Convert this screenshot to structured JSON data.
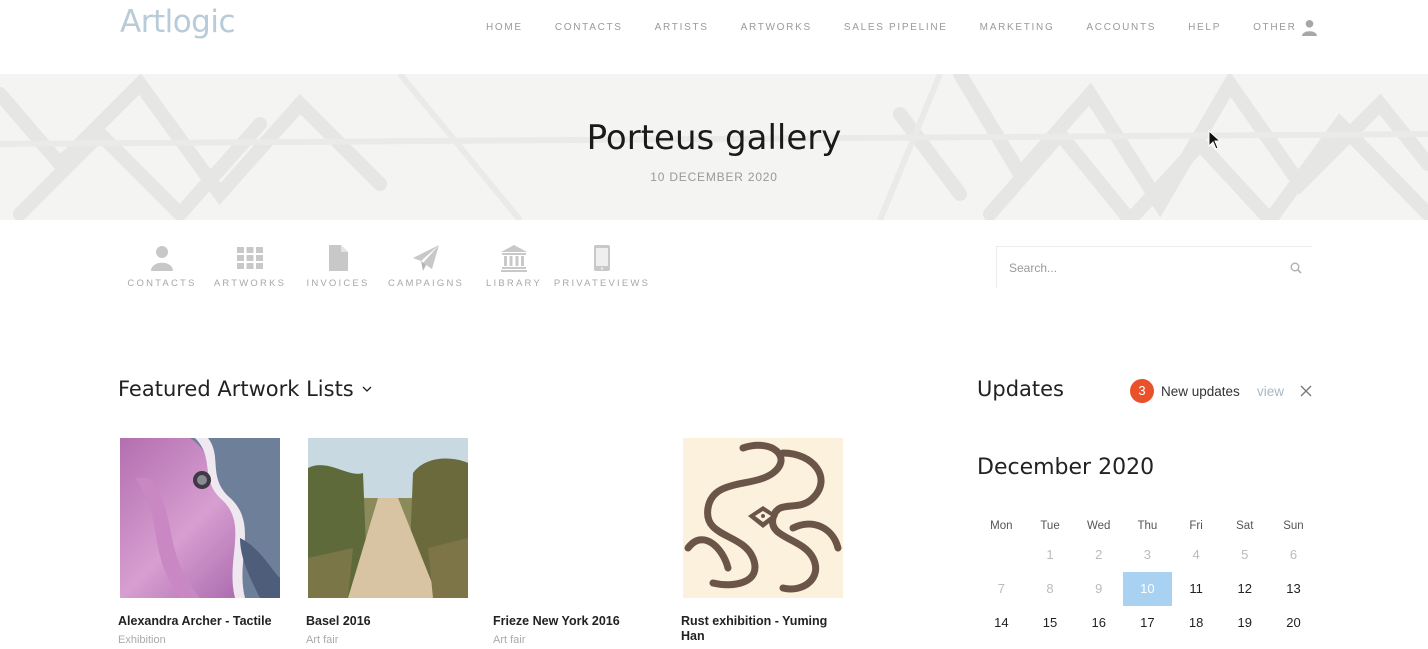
{
  "header": {
    "logo": "Artlogic",
    "nav": [
      "HOME",
      "CONTACTS",
      "ARTISTS",
      "ARTWORKS",
      "SALES PIPELINE",
      "MARKETING",
      "ACCOUNTS",
      "HELP",
      "OTHER"
    ]
  },
  "banner": {
    "title": "Porteus gallery",
    "date": "10 DECEMBER 2020"
  },
  "quick_links": [
    {
      "label": "CONTACTS",
      "icon": "person-icon"
    },
    {
      "label": "ARTWORKS",
      "icon": "grid-icon"
    },
    {
      "label": "INVOICES",
      "icon": "document-icon"
    },
    {
      "label": "CAMPAIGNS",
      "icon": "paper-plane-icon"
    },
    {
      "label": "LIBRARY",
      "icon": "bank-icon"
    },
    {
      "label": "PRIVATEVIEWS",
      "icon": "tablet-icon"
    }
  ],
  "search": {
    "placeholder": "Search..."
  },
  "featured": {
    "title": "Featured Artwork Lists",
    "cards": [
      {
        "name": "Alexandra Archer - Tactile",
        "type": "Exhibition"
      },
      {
        "name": "Basel 2016",
        "type": "Art fair"
      },
      {
        "name": "Frieze New York 2016",
        "type": "Art fair"
      },
      {
        "name": "Rust exhibition - Yuming Han",
        "type": ""
      }
    ]
  },
  "updates": {
    "title": "Updates",
    "count": "3",
    "label": "New updates",
    "view": "view"
  },
  "calendar": {
    "month": "December 2020",
    "weekdays": [
      "Mon",
      "Tue",
      "Wed",
      "Thu",
      "Fri",
      "Sat",
      "Sun"
    ],
    "rows": [
      [
        "",
        "1",
        "2",
        "3",
        "4",
        "5",
        "6"
      ],
      [
        "7",
        "8",
        "9",
        "10",
        "11",
        "12",
        "13"
      ],
      [
        "14",
        "15",
        "16",
        "17",
        "18",
        "19",
        "20"
      ]
    ],
    "today": "10"
  },
  "colors": {
    "accent": "#a9d2f2",
    "badge": "#e8512a",
    "logo": "#b7ccd8",
    "link": "#a8b8c4"
  }
}
